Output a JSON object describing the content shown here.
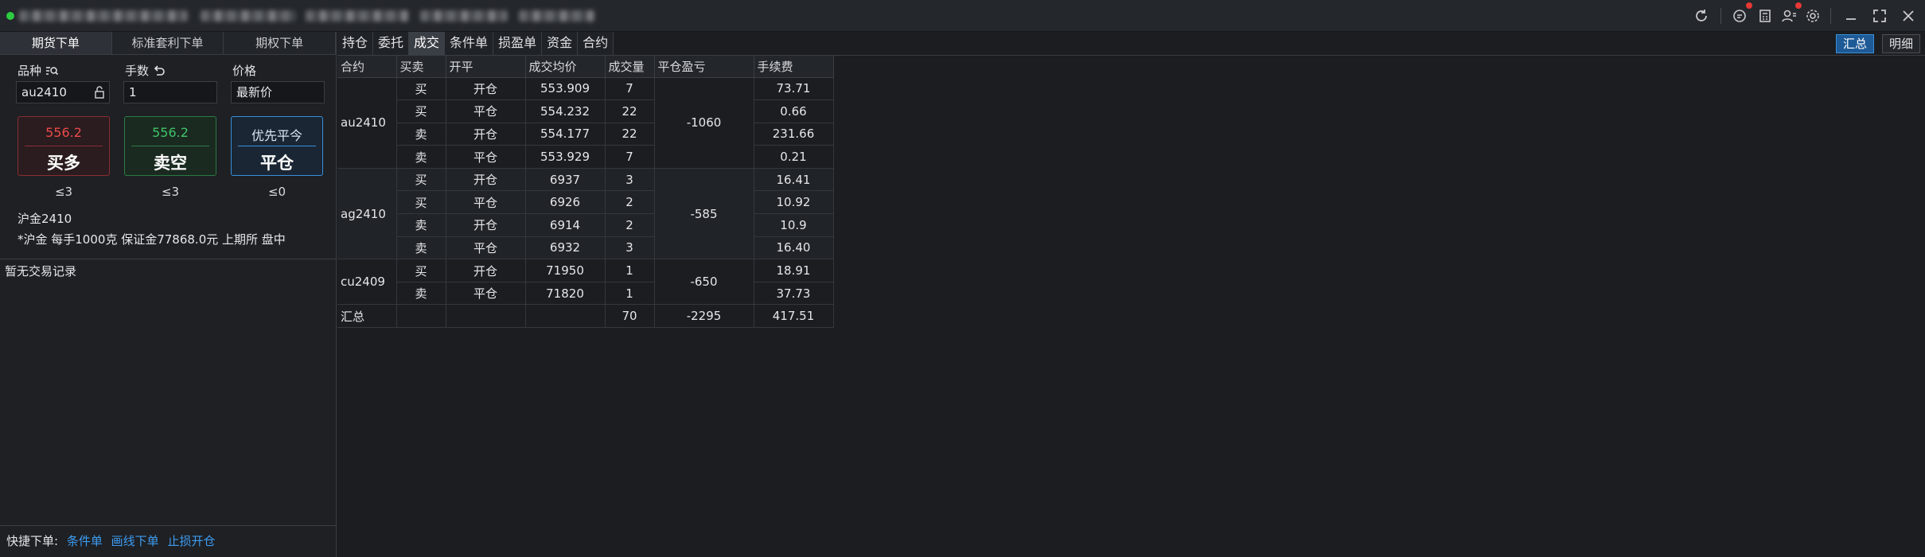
{
  "window": {
    "icons": [
      "refresh-icon",
      "message-icon",
      "calculator-icon",
      "user-icon",
      "settings-icon",
      "minimize-icon",
      "maximize-icon",
      "close-icon"
    ]
  },
  "left": {
    "tabs": [
      "期货下单",
      "标准套利下单",
      "期权下单"
    ],
    "fields": {
      "symbol_label": "品种",
      "qty_label": "手数",
      "price_label": "价格",
      "symbol_value": "au2410",
      "qty_value": "1",
      "price_value": "最新价"
    },
    "buttons": {
      "buy": {
        "price": "556.2",
        "label": "买多"
      },
      "sell": {
        "price": "556.2",
        "label": "卖空"
      },
      "close": {
        "price": "优先平今",
        "label": "平仓"
      }
    },
    "limits": [
      "≤3",
      "≤3",
      "≤0"
    ],
    "contract_name": "沪金2410",
    "contract_info": "*沪金 每手1000克 保证金77868.0元 上期所 盘中",
    "no_record": "暂无交易记录",
    "quick": {
      "label": "快捷下单:",
      "links": [
        "条件单",
        "画线下单",
        "止损开仓"
      ]
    }
  },
  "right": {
    "tabs": [
      "持仓",
      "委托",
      "成交",
      "条件单",
      "损盈单",
      "资金",
      "合约"
    ],
    "active_tab": 2,
    "view_buttons": [
      "汇总",
      "明细"
    ],
    "columns": [
      "合约",
      "买卖",
      "开平",
      "成交均价",
      "成交量",
      "平仓盈亏",
      "手续费"
    ],
    "groups": [
      {
        "contract": "au2410",
        "pnl": "-1060",
        "rows": [
          {
            "side": "买",
            "oc": "开仓",
            "price": "553.909",
            "qty": "7",
            "fee": "73.71"
          },
          {
            "side": "买",
            "oc": "平仓",
            "price": "554.232",
            "qty": "22",
            "fee": "0.66"
          },
          {
            "side": "卖",
            "oc": "开仓",
            "price": "554.177",
            "qty": "22",
            "fee": "231.66"
          },
          {
            "side": "卖",
            "oc": "平仓",
            "price": "553.929",
            "qty": "7",
            "fee": "0.21"
          }
        ]
      },
      {
        "contract": "ag2410",
        "pnl": "-585",
        "rows": [
          {
            "side": "买",
            "oc": "开仓",
            "price": "6937",
            "qty": "3",
            "fee": "16.41"
          },
          {
            "side": "买",
            "oc": "平仓",
            "price": "6926",
            "qty": "2",
            "fee": "10.92"
          },
          {
            "side": "卖",
            "oc": "开仓",
            "price": "6914",
            "qty": "2",
            "fee": "10.9"
          },
          {
            "side": "卖",
            "oc": "平仓",
            "price": "6932",
            "qty": "3",
            "fee": "16.40"
          }
        ]
      },
      {
        "contract": "cu2409",
        "pnl": "-650",
        "rows": [
          {
            "side": "买",
            "oc": "开仓",
            "price": "71950",
            "qty": "1",
            "fee": "18.91"
          },
          {
            "side": "卖",
            "oc": "平仓",
            "price": "71820",
            "qty": "1",
            "fee": "37.73"
          }
        ]
      }
    ],
    "total": {
      "label": "汇总",
      "qty": "70",
      "pnl": "-2295",
      "fee": "417.51"
    }
  },
  "colors": {
    "buy": "#ea4a4a",
    "sell": "#3fc36a",
    "accent": "#3a8fd8"
  }
}
